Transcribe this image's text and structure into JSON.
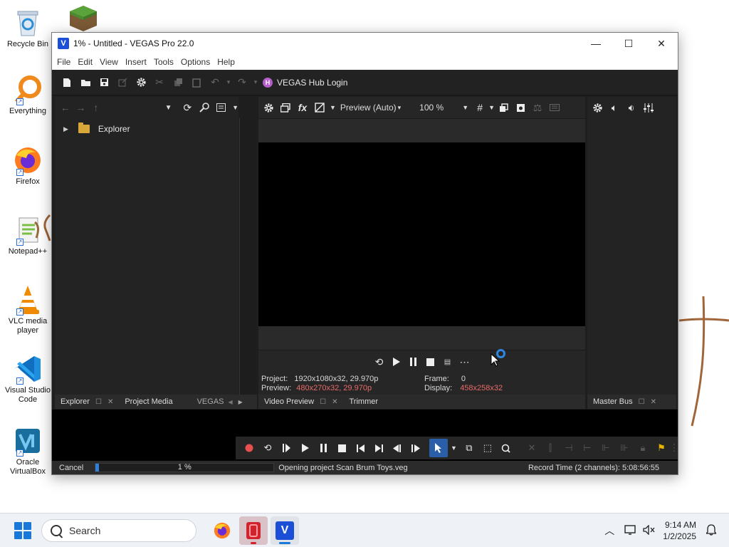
{
  "desktop": {
    "icons": [
      {
        "label": "Recycle Bin",
        "icon": "recycle-bin-icon"
      },
      {
        "label": "Everything",
        "icon": "everything-search-icon"
      },
      {
        "label": "Firefox",
        "icon": "firefox-icon"
      },
      {
        "label": "Notepad++",
        "icon": "notepad-plus-plus-icon"
      },
      {
        "label": "VLC media player",
        "icon": "vlc-cone-icon"
      },
      {
        "label": "Visual Studio Code",
        "icon": "vscode-icon"
      },
      {
        "label": "Oracle VirtualBox",
        "icon": "virtualbox-icon"
      },
      {
        "label": "",
        "icon": "minecraft-block-icon"
      }
    ]
  },
  "window": {
    "title": "1% - Untitled - VEGAS Pro 22.0",
    "logo_letter": "V",
    "controls": {
      "minimize": "—",
      "maximize": "☐",
      "close": "✕"
    }
  },
  "menu": [
    "File",
    "Edit",
    "View",
    "Insert",
    "Tools",
    "Options",
    "Help"
  ],
  "toolbar": {
    "hub_label": "VEGAS Hub Login"
  },
  "explorer": {
    "tree_item": "Explorer"
  },
  "preview": {
    "mode": "Preview (Auto)",
    "zoom": "100 %",
    "project_label": "Project:",
    "project_value": "1920x1080x32, 29.970p",
    "preview_label": "Preview:",
    "preview_value": "480x270x32, 29.970p",
    "frame_label": "Frame:",
    "frame_value": "0",
    "display_label": "Display:",
    "display_value": "458x258x32"
  },
  "tabs": {
    "left": [
      "Explorer",
      "Project Media",
      "VEGAS"
    ],
    "center": [
      "Video Preview",
      "Trimmer"
    ],
    "right": [
      "Master Bus"
    ]
  },
  "status": {
    "cancel": "Cancel",
    "progress_text": "1 %",
    "progress_fraction": 0.01,
    "message": "Opening project Scan Brum Toys.veg",
    "record_time": "Record Time (2 channels): 5:08:56:55"
  },
  "taskbar": {
    "search_placeholder": "Search",
    "time": "9:14 AM",
    "date": "1/2/2025"
  },
  "colors": {
    "accent": "#1b4fd8",
    "progress": "#2f7fd8",
    "warning_text": "#e86a6a"
  }
}
